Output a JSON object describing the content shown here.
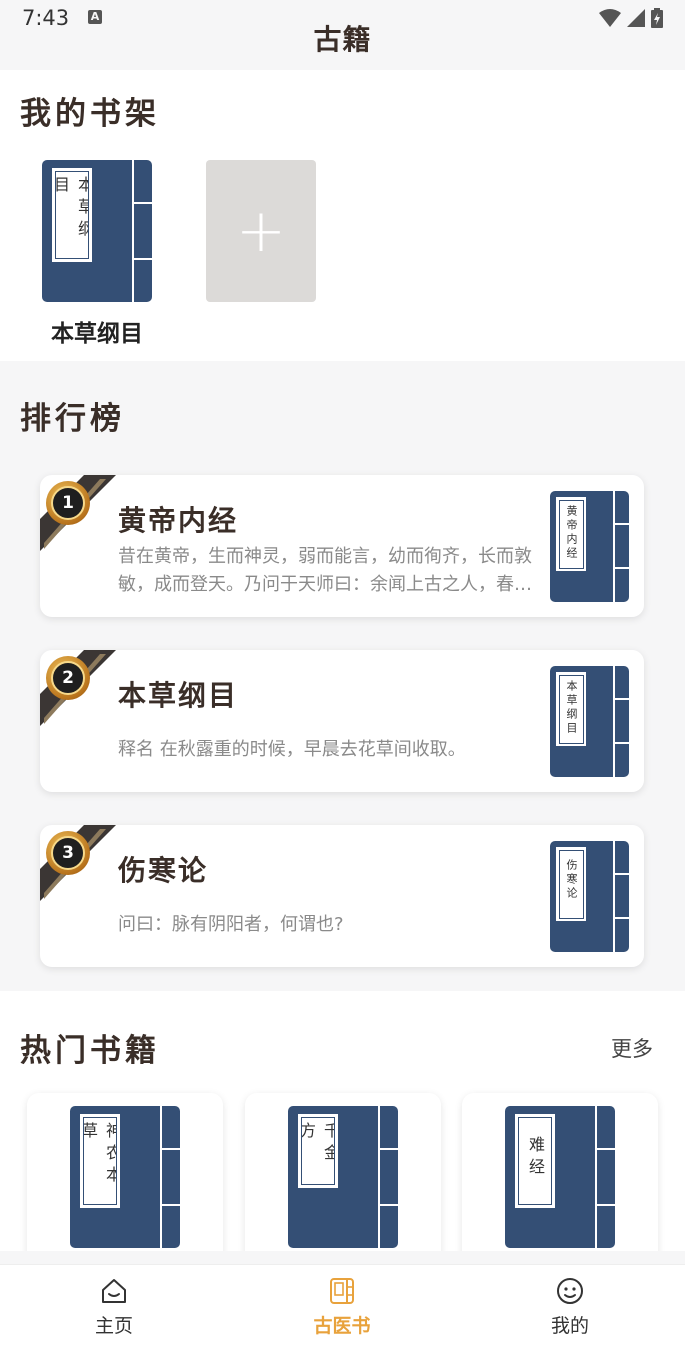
{
  "status_bar": {
    "time": "7:43",
    "a_icon": "A"
  },
  "header": {
    "title": "古籍"
  },
  "bookshelf": {
    "title": "我的书架",
    "books": [
      {
        "name": "本草纲目",
        "cover_text": "本草纲目"
      }
    ],
    "add_icon": "+"
  },
  "ranking": {
    "title": "排行榜",
    "items": [
      {
        "rank": "1",
        "title": "黄帝内经",
        "description": "昔在黄帝，生而神灵，弱而能言，幼而徇齐，长而敦敏，成而登天。乃问于天师曰：余闻上古之人，春秋皆度百岁",
        "cover_text": "黄帝内经"
      },
      {
        "rank": "2",
        "title": "本草纲目",
        "description": "释名 在秋露重的时候，早晨去花草间收取。",
        "cover_text": "本草纲目"
      },
      {
        "rank": "3",
        "title": "伤寒论",
        "description": "问曰：脉有阴阳者，何谓也?",
        "cover_text": "伤寒论"
      }
    ]
  },
  "hot_books": {
    "title": "热门书籍",
    "more_label": "更多",
    "items": [
      {
        "cover_text": "神农本草"
      },
      {
        "cover_text": "千金方"
      },
      {
        "cover_text": "难经"
      }
    ]
  },
  "bottom_nav": {
    "items": [
      {
        "label": "主页",
        "icon": "home-icon"
      },
      {
        "label": "古医书",
        "icon": "book-icon",
        "active": true
      },
      {
        "label": "我的",
        "icon": "smiley-icon"
      }
    ]
  },
  "colors": {
    "cover_blue": "#344f75",
    "accent_orange": "#e8a23c",
    "title_brown": "#3a2e28",
    "medal_gold": "#d89a3a"
  }
}
